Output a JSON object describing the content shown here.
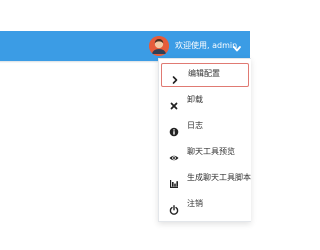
{
  "header": {
    "welcome_text": "欢迎使用, admin",
    "accent_color": "#3b9ce5",
    "avatar_icon": "user-avatar-icon",
    "dropdown_icon": "chevron-down-icon"
  },
  "user_menu": {
    "items": [
      {
        "label": "编辑配置",
        "icon": "chevron-right-icon",
        "active": true
      },
      {
        "label": "卸载",
        "icon": "close-icon"
      },
      {
        "label": "日志",
        "icon": "info-icon"
      },
      {
        "label": "聊天工具预览",
        "icon": "eye-icon"
      },
      {
        "label": "生成聊天工具脚本",
        "icon": "bar-chart-icon"
      },
      {
        "label": "注销",
        "icon": "power-icon"
      }
    ]
  }
}
